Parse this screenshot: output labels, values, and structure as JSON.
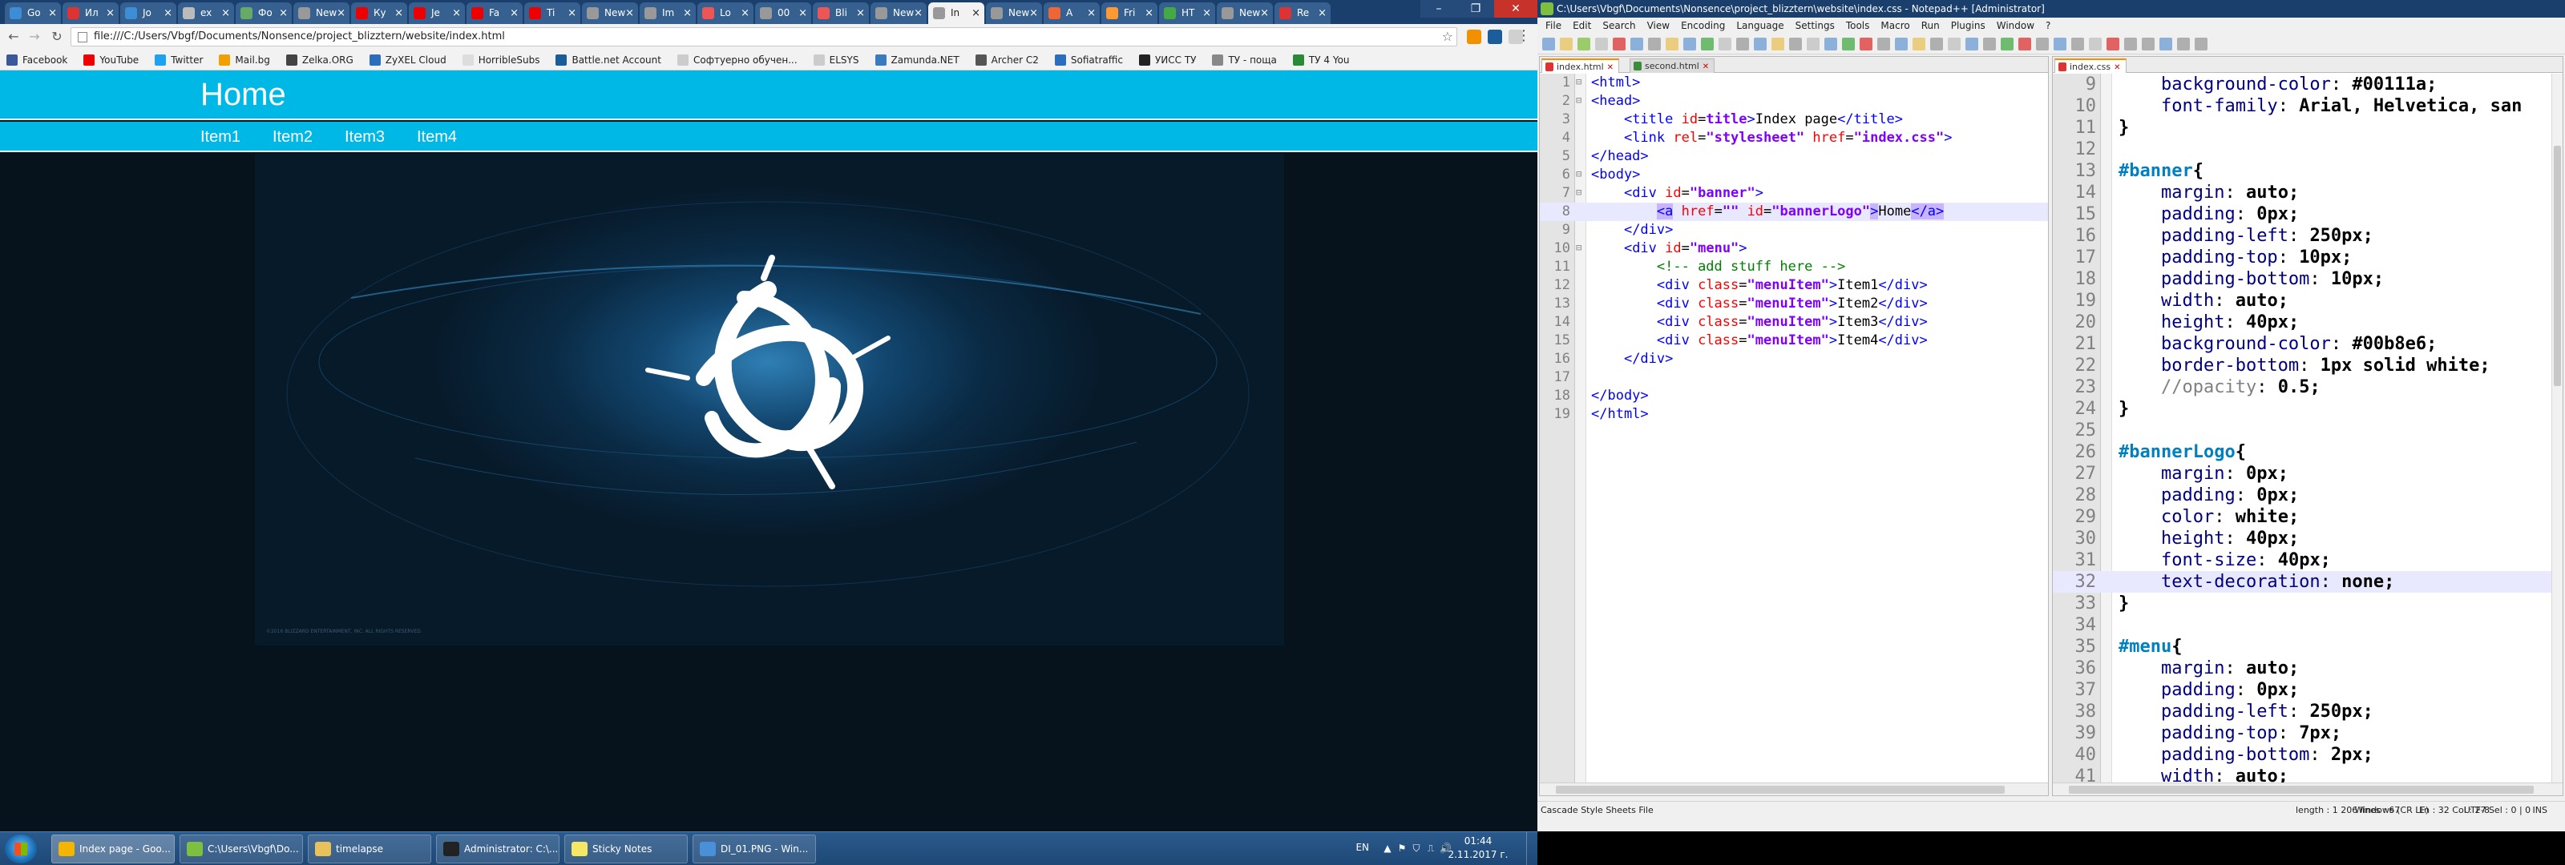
{
  "chrome": {
    "tabs": [
      {
        "label": "Go",
        "color": "#3c8cd6"
      },
      {
        "label": "Ил",
        "color": "#d33"
      },
      {
        "label": "Jo",
        "color": "#3c8cd6"
      },
      {
        "label": "ex",
        "color": "#bbb"
      },
      {
        "label": "Фо",
        "color": "#6a6"
      },
      {
        "label": "New",
        "color": "#999"
      },
      {
        "label": "Ку",
        "color": "#e00"
      },
      {
        "label": "Je",
        "color": "#e00"
      },
      {
        "label": "Fa",
        "color": "#e00"
      },
      {
        "label": "Ti",
        "color": "#e00"
      },
      {
        "label": "New",
        "color": "#999"
      },
      {
        "label": "Im",
        "color": "#999"
      },
      {
        "label": "Lo",
        "color": "#e55"
      },
      {
        "label": "00",
        "color": "#999"
      },
      {
        "label": "Bli",
        "color": "#e55"
      },
      {
        "label": "New",
        "color": "#999"
      },
      {
        "label": "In",
        "color": "#999",
        "active": true
      },
      {
        "label": "New",
        "color": "#999"
      },
      {
        "label": "A",
        "color": "#e63"
      },
      {
        "label": "Fri",
        "color": "#f93"
      },
      {
        "label": "HT",
        "color": "#4a4"
      },
      {
        "label": "New",
        "color": "#999"
      },
      {
        "label": "Re",
        "color": "#d33"
      }
    ],
    "window_controls": {
      "minimize": "–",
      "maximize": "❐",
      "close": "✕"
    },
    "nav": {
      "back": "←",
      "forward": "→",
      "reload": "↻"
    },
    "url": "file:///C:/Users/Vbgf/Documents/Nonsence/project_blizztern/website/index.html",
    "star_icon": "☆",
    "menu_icon": "⋮",
    "bookmarks": [
      {
        "label": "Facebook",
        "color": "#3b5998"
      },
      {
        "label": "YouTube",
        "color": "#e00"
      },
      {
        "label": "Twitter",
        "color": "#1da1f2"
      },
      {
        "label": "Mail.bg",
        "color": "#f0a000"
      },
      {
        "label": "Zelka.ORG",
        "color": "#444"
      },
      {
        "label": "ZyXEL Cloud",
        "color": "#2a6ebd"
      },
      {
        "label": "HorribleSubs",
        "color": "#ddd"
      },
      {
        "label": "Battle.net Account",
        "color": "#1a5d9a"
      },
      {
        "label": "Софтуерно обучен...",
        "color": "#ccc"
      },
      {
        "label": "ELSYS",
        "color": "#ccc"
      },
      {
        "label": "Zamunda.NET",
        "color": "#3a7abf"
      },
      {
        "label": "Archer C2",
        "color": "#555"
      },
      {
        "label": "Sofiatraffic",
        "color": "#2a6ebd"
      },
      {
        "label": "УИСС ТУ",
        "color": "#222"
      },
      {
        "label": "ТУ - поща",
        "color": "#888"
      },
      {
        "label": "ТУ 4 You",
        "color": "#2a8a3a"
      }
    ]
  },
  "website": {
    "banner_logo": "Home",
    "menu_items": [
      "Item1",
      "Item2",
      "Item3",
      "Item4"
    ],
    "banner_color": "#00b8e6",
    "hero_copyright": "©2016 BLIZZARD ENTERTAINMENT, INC. ALL RIGHTS RESERVED."
  },
  "npp": {
    "title": "C:\\Users\\Vbgf\\Documents\\Nonsence\\project_blizztern\\website\\index.css - Notepad++ [Administrator]",
    "menu": [
      "File",
      "Edit",
      "Search",
      "View",
      "Encoding",
      "Language",
      "Settings",
      "Tools",
      "Macro",
      "Run",
      "Plugins",
      "Window",
      "?"
    ],
    "left_tabs": [
      "index.html",
      "second.html"
    ],
    "right_tabs": [
      "index.css"
    ],
    "status": {
      "filetype": "Cascade Style Sheets File",
      "length": "length : 1 206",
      "lines": "lines : 67",
      "position": "Ln : 32    Col : 27    Sel : 0 | 0",
      "eol": "Windows (CR LF)",
      "encoding": "UTF-8",
      "mode": "INS"
    }
  },
  "html_code": [
    {
      "n": "1",
      "parts": [
        [
          "tag",
          "<html>"
        ]
      ]
    },
    {
      "n": "2",
      "parts": [
        [
          "tag",
          "<head>"
        ]
      ]
    },
    {
      "n": "3",
      "parts": [
        [
          "plain",
          "    "
        ],
        [
          "tag",
          "<title "
        ],
        [
          "attr",
          "id"
        ],
        [
          "plain",
          "="
        ],
        [
          "val",
          "title"
        ],
        [
          "tag",
          ">"
        ],
        [
          "plain",
          "Index page"
        ],
        [
          "tag",
          "</title>"
        ]
      ]
    },
    {
      "n": "4",
      "parts": [
        [
          "plain",
          "    "
        ],
        [
          "tag",
          "<link "
        ],
        [
          "attr",
          "rel"
        ],
        [
          "plain",
          "="
        ],
        [
          "val",
          "\"stylesheet\""
        ],
        [
          "plain",
          " "
        ],
        [
          "attr",
          "href"
        ],
        [
          "plain",
          "="
        ],
        [
          "val",
          "\"index.css\""
        ],
        [
          "tag",
          ">"
        ]
      ]
    },
    {
      "n": "5",
      "parts": [
        [
          "tag",
          "</head>"
        ]
      ]
    },
    {
      "n": "6",
      "parts": [
        [
          "tag",
          "<body>"
        ]
      ]
    },
    {
      "n": "7",
      "parts": [
        [
          "plain",
          "    "
        ],
        [
          "tag",
          "<div "
        ],
        [
          "attr",
          "id"
        ],
        [
          "plain",
          "="
        ],
        [
          "val",
          "\"banner\""
        ],
        [
          "tag",
          ">"
        ]
      ]
    },
    {
      "n": "8",
      "hl": true,
      "parts": [
        [
          "plain",
          "        "
        ],
        [
          "hltag",
          "<a"
        ],
        [
          "plain",
          " "
        ],
        [
          "attr",
          "href"
        ],
        [
          "plain",
          "="
        ],
        [
          "val",
          "\"\""
        ],
        [
          "plain",
          " "
        ],
        [
          "attr",
          "id"
        ],
        [
          "plain",
          "="
        ],
        [
          "val",
          "\"bannerLogo\""
        ],
        [
          "hltag",
          ">"
        ],
        [
          "plain",
          "Home"
        ],
        [
          "hltag",
          "</a>"
        ]
      ]
    },
    {
      "n": "9",
      "parts": [
        [
          "plain",
          "    "
        ],
        [
          "tag",
          "</div>"
        ]
      ]
    },
    {
      "n": "10",
      "parts": [
        [
          "plain",
          "    "
        ],
        [
          "tag",
          "<div "
        ],
        [
          "attr",
          "id"
        ],
        [
          "plain",
          "="
        ],
        [
          "val",
          "\"menu\""
        ],
        [
          "tag",
          ">"
        ]
      ]
    },
    {
      "n": "11",
      "parts": [
        [
          "plain",
          "        "
        ],
        [
          "cmt",
          "<!-- add stuff here -->"
        ]
      ]
    },
    {
      "n": "12",
      "parts": [
        [
          "plain",
          "        "
        ],
        [
          "tag",
          "<div "
        ],
        [
          "attr",
          "class"
        ],
        [
          "plain",
          "="
        ],
        [
          "val",
          "\"menuItem\""
        ],
        [
          "tag",
          ">"
        ],
        [
          "plain",
          "Item1"
        ],
        [
          "tag",
          "</div>"
        ]
      ]
    },
    {
      "n": "13",
      "parts": [
        [
          "plain",
          "        "
        ],
        [
          "tag",
          "<div "
        ],
        [
          "attr",
          "class"
        ],
        [
          "plain",
          "="
        ],
        [
          "val",
          "\"menuItem\""
        ],
        [
          "tag",
          ">"
        ],
        [
          "plain",
          "Item2"
        ],
        [
          "tag",
          "</div>"
        ]
      ]
    },
    {
      "n": "14",
      "parts": [
        [
          "plain",
          "        "
        ],
        [
          "tag",
          "<div "
        ],
        [
          "attr",
          "class"
        ],
        [
          "plain",
          "="
        ],
        [
          "val",
          "\"menuItem\""
        ],
        [
          "tag",
          ">"
        ],
        [
          "plain",
          "Item3"
        ],
        [
          "tag",
          "</div>"
        ]
      ]
    },
    {
      "n": "15",
      "parts": [
        [
          "plain",
          "        "
        ],
        [
          "tag",
          "<div "
        ],
        [
          "attr",
          "class"
        ],
        [
          "plain",
          "="
        ],
        [
          "val",
          "\"menuItem\""
        ],
        [
          "tag",
          ">"
        ],
        [
          "plain",
          "Item4"
        ],
        [
          "tag",
          "</div>"
        ]
      ]
    },
    {
      "n": "16",
      "parts": [
        [
          "plain",
          "    "
        ],
        [
          "tag",
          "</div>"
        ]
      ]
    },
    {
      "n": "17",
      "parts": []
    },
    {
      "n": "18",
      "parts": [
        [
          "tag",
          "</body>"
        ]
      ]
    },
    {
      "n": "19",
      "parts": [
        [
          "tag",
          "</html>"
        ]
      ]
    }
  ],
  "css_code": [
    {
      "n": "9",
      "parts": [
        [
          "plain",
          "    "
        ],
        [
          "prop",
          "background-color"
        ],
        [
          "plain",
          ": "
        ],
        [
          "pval",
          "#00111a;"
        ]
      ]
    },
    {
      "n": "10",
      "parts": [
        [
          "plain",
          "    "
        ],
        [
          "prop",
          "font-family"
        ],
        [
          "plain",
          ": "
        ],
        [
          "pval",
          "Arial, Helvetica, san"
        ]
      ]
    },
    {
      "n": "11",
      "parts": [
        [
          "brace",
          "}"
        ]
      ]
    },
    {
      "n": "12",
      "parts": []
    },
    {
      "n": "13",
      "parts": [
        [
          "sel",
          "#banner"
        ],
        [
          "brace",
          "{"
        ]
      ]
    },
    {
      "n": "14",
      "parts": [
        [
          "plain",
          "    "
        ],
        [
          "prop",
          "margin"
        ],
        [
          "plain",
          ": "
        ],
        [
          "pval",
          "auto;"
        ]
      ]
    },
    {
      "n": "15",
      "parts": [
        [
          "plain",
          "    "
        ],
        [
          "prop",
          "padding"
        ],
        [
          "plain",
          ": "
        ],
        [
          "pval",
          "0px;"
        ]
      ]
    },
    {
      "n": "16",
      "parts": [
        [
          "plain",
          "    "
        ],
        [
          "prop",
          "padding-left"
        ],
        [
          "plain",
          ": "
        ],
        [
          "pval",
          "250px;"
        ]
      ]
    },
    {
      "n": "17",
      "parts": [
        [
          "plain",
          "    "
        ],
        [
          "prop",
          "padding-top"
        ],
        [
          "plain",
          ": "
        ],
        [
          "pval",
          "10px;"
        ]
      ]
    },
    {
      "n": "18",
      "parts": [
        [
          "plain",
          "    "
        ],
        [
          "prop",
          "padding-bottom"
        ],
        [
          "plain",
          ": "
        ],
        [
          "pval",
          "10px;"
        ]
      ]
    },
    {
      "n": "19",
      "parts": [
        [
          "plain",
          "    "
        ],
        [
          "prop",
          "width"
        ],
        [
          "plain",
          ": "
        ],
        [
          "pval",
          "auto;"
        ]
      ]
    },
    {
      "n": "20",
      "parts": [
        [
          "plain",
          "    "
        ],
        [
          "prop",
          "height"
        ],
        [
          "plain",
          ": "
        ],
        [
          "pval",
          "40px;"
        ]
      ]
    },
    {
      "n": "21",
      "parts": [
        [
          "plain",
          "    "
        ],
        [
          "prop",
          "background-color"
        ],
        [
          "plain",
          ": "
        ],
        [
          "pval",
          "#00b8e6;"
        ]
      ]
    },
    {
      "n": "22",
      "parts": [
        [
          "plain",
          "    "
        ],
        [
          "prop",
          "border-bottom"
        ],
        [
          "plain",
          ": "
        ],
        [
          "pval",
          "1px solid white;"
        ]
      ]
    },
    {
      "n": "23",
      "parts": [
        [
          "plain",
          "    "
        ],
        [
          "cmtc",
          "//opacity"
        ],
        [
          "plain",
          ": "
        ],
        [
          "pval",
          "0.5;"
        ]
      ]
    },
    {
      "n": "24",
      "parts": [
        [
          "brace",
          "}"
        ]
      ]
    },
    {
      "n": "25",
      "parts": []
    },
    {
      "n": "26",
      "parts": [
        [
          "sel",
          "#bannerLogo"
        ],
        [
          "brace",
          "{"
        ]
      ]
    },
    {
      "n": "27",
      "parts": [
        [
          "plain",
          "    "
        ],
        [
          "prop",
          "margin"
        ],
        [
          "plain",
          ": "
        ],
        [
          "pval",
          "0px;"
        ]
      ]
    },
    {
      "n": "28",
      "parts": [
        [
          "plain",
          "    "
        ],
        [
          "prop",
          "padding"
        ],
        [
          "plain",
          ": "
        ],
        [
          "pval",
          "0px;"
        ]
      ]
    },
    {
      "n": "29",
      "parts": [
        [
          "plain",
          "    "
        ],
        [
          "prop",
          "color"
        ],
        [
          "plain",
          ": "
        ],
        [
          "pval",
          "white;"
        ]
      ]
    },
    {
      "n": "30",
      "parts": [
        [
          "plain",
          "    "
        ],
        [
          "prop",
          "height"
        ],
        [
          "plain",
          ": "
        ],
        [
          "pval",
          "40px;"
        ]
      ]
    },
    {
      "n": "31",
      "parts": [
        [
          "plain",
          "    "
        ],
        [
          "prop",
          "font-size"
        ],
        [
          "plain",
          ": "
        ],
        [
          "pval",
          "40px;"
        ]
      ]
    },
    {
      "n": "32",
      "hl": true,
      "parts": [
        [
          "plain",
          "    "
        ],
        [
          "prop",
          "text-decoration"
        ],
        [
          "plain",
          ": "
        ],
        [
          "pval",
          "none;"
        ]
      ]
    },
    {
      "n": "33",
      "parts": [
        [
          "brace",
          "}"
        ]
      ]
    },
    {
      "n": "34",
      "parts": []
    },
    {
      "n": "35",
      "parts": [
        [
          "sel",
          "#menu"
        ],
        [
          "brace",
          "{"
        ]
      ]
    },
    {
      "n": "36",
      "parts": [
        [
          "plain",
          "    "
        ],
        [
          "prop",
          "margin"
        ],
        [
          "plain",
          ": "
        ],
        [
          "pval",
          "auto;"
        ]
      ]
    },
    {
      "n": "37",
      "parts": [
        [
          "plain",
          "    "
        ],
        [
          "prop",
          "padding"
        ],
        [
          "plain",
          ": "
        ],
        [
          "pval",
          "0px;"
        ]
      ]
    },
    {
      "n": "38",
      "parts": [
        [
          "plain",
          "    "
        ],
        [
          "prop",
          "padding-left"
        ],
        [
          "plain",
          ": "
        ],
        [
          "pval",
          "250px;"
        ]
      ]
    },
    {
      "n": "39",
      "parts": [
        [
          "plain",
          "    "
        ],
        [
          "prop",
          "padding-top"
        ],
        [
          "plain",
          ": "
        ],
        [
          "pval",
          "7px;"
        ]
      ]
    },
    {
      "n": "40",
      "parts": [
        [
          "plain",
          "    "
        ],
        [
          "prop",
          "padding-bottom"
        ],
        [
          "plain",
          ": "
        ],
        [
          "pval",
          "2px;"
        ]
      ]
    },
    {
      "n": "41",
      "parts": [
        [
          "plain",
          "    "
        ],
        [
          "prop",
          "width"
        ],
        [
          "plain",
          ": "
        ],
        [
          "pval",
          "auto;"
        ]
      ]
    }
  ],
  "taskbar": {
    "buttons": [
      {
        "label": "Index page - Goo...",
        "color": "#f4b400",
        "active": true
      },
      {
        "label": "C:\\Users\\Vbgf\\Do...",
        "color": "#7fbf3f"
      },
      {
        "label": "timelapse",
        "color": "#e8c15a"
      },
      {
        "label": "Administrator: C:\\...",
        "color": "#222"
      },
      {
        "label": "Sticky Notes",
        "color": "#f5e663"
      },
      {
        "label": "DI_01.PNG - Win...",
        "color": "#4a90d9"
      }
    ],
    "lang": "EN",
    "tray_icons": [
      "▲",
      "⚑",
      "⛉",
      "⎍",
      "🔊"
    ],
    "time": "01:44",
    "date": "2.11.2017 г."
  }
}
